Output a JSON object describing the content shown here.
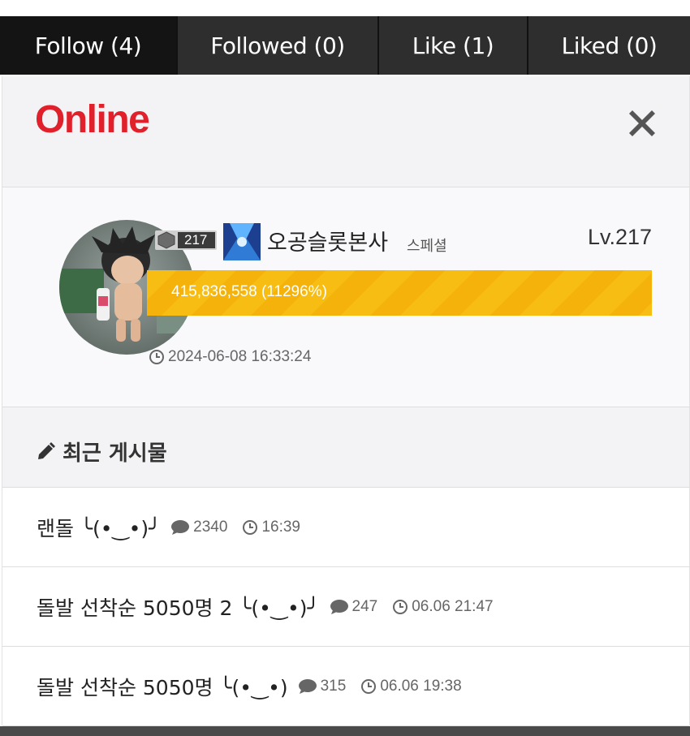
{
  "tabs": [
    {
      "label": "Follow (4)",
      "active": true
    },
    {
      "label": "Followed (0)",
      "active": false
    },
    {
      "label": "Like (1)",
      "active": false
    },
    {
      "label": "Liked (0)",
      "active": false
    }
  ],
  "header": {
    "title": "Online",
    "close_icon": "close-icon"
  },
  "profile": {
    "rank": "217",
    "username": "오공슬롯본사",
    "user_type": "스페셜",
    "level": "Lv.217",
    "xp_text": "415,836,558 (11296%)",
    "xp_fill": 1.0,
    "last_login": "2024-06-08 16:33:24"
  },
  "recent": {
    "title": "최근 게시물",
    "posts": [
      {
        "title": "랜돌 ╰(•‿•)╯",
        "comments": "2340",
        "time": "16:39"
      },
      {
        "title": "돌발 선착순 5050명 2 ╰(•‿•)╯",
        "comments": "247",
        "time": "06.06 21:47"
      },
      {
        "title": "돌발 선착순 5050명 ╰(•‿•)",
        "comments": "315",
        "time": "06.06 19:38"
      }
    ]
  },
  "colors": {
    "accent": "#e0202b",
    "xp_bar": "#f8bd13",
    "tab_bg": "#2e2e2e",
    "tab_active": "#141414"
  }
}
